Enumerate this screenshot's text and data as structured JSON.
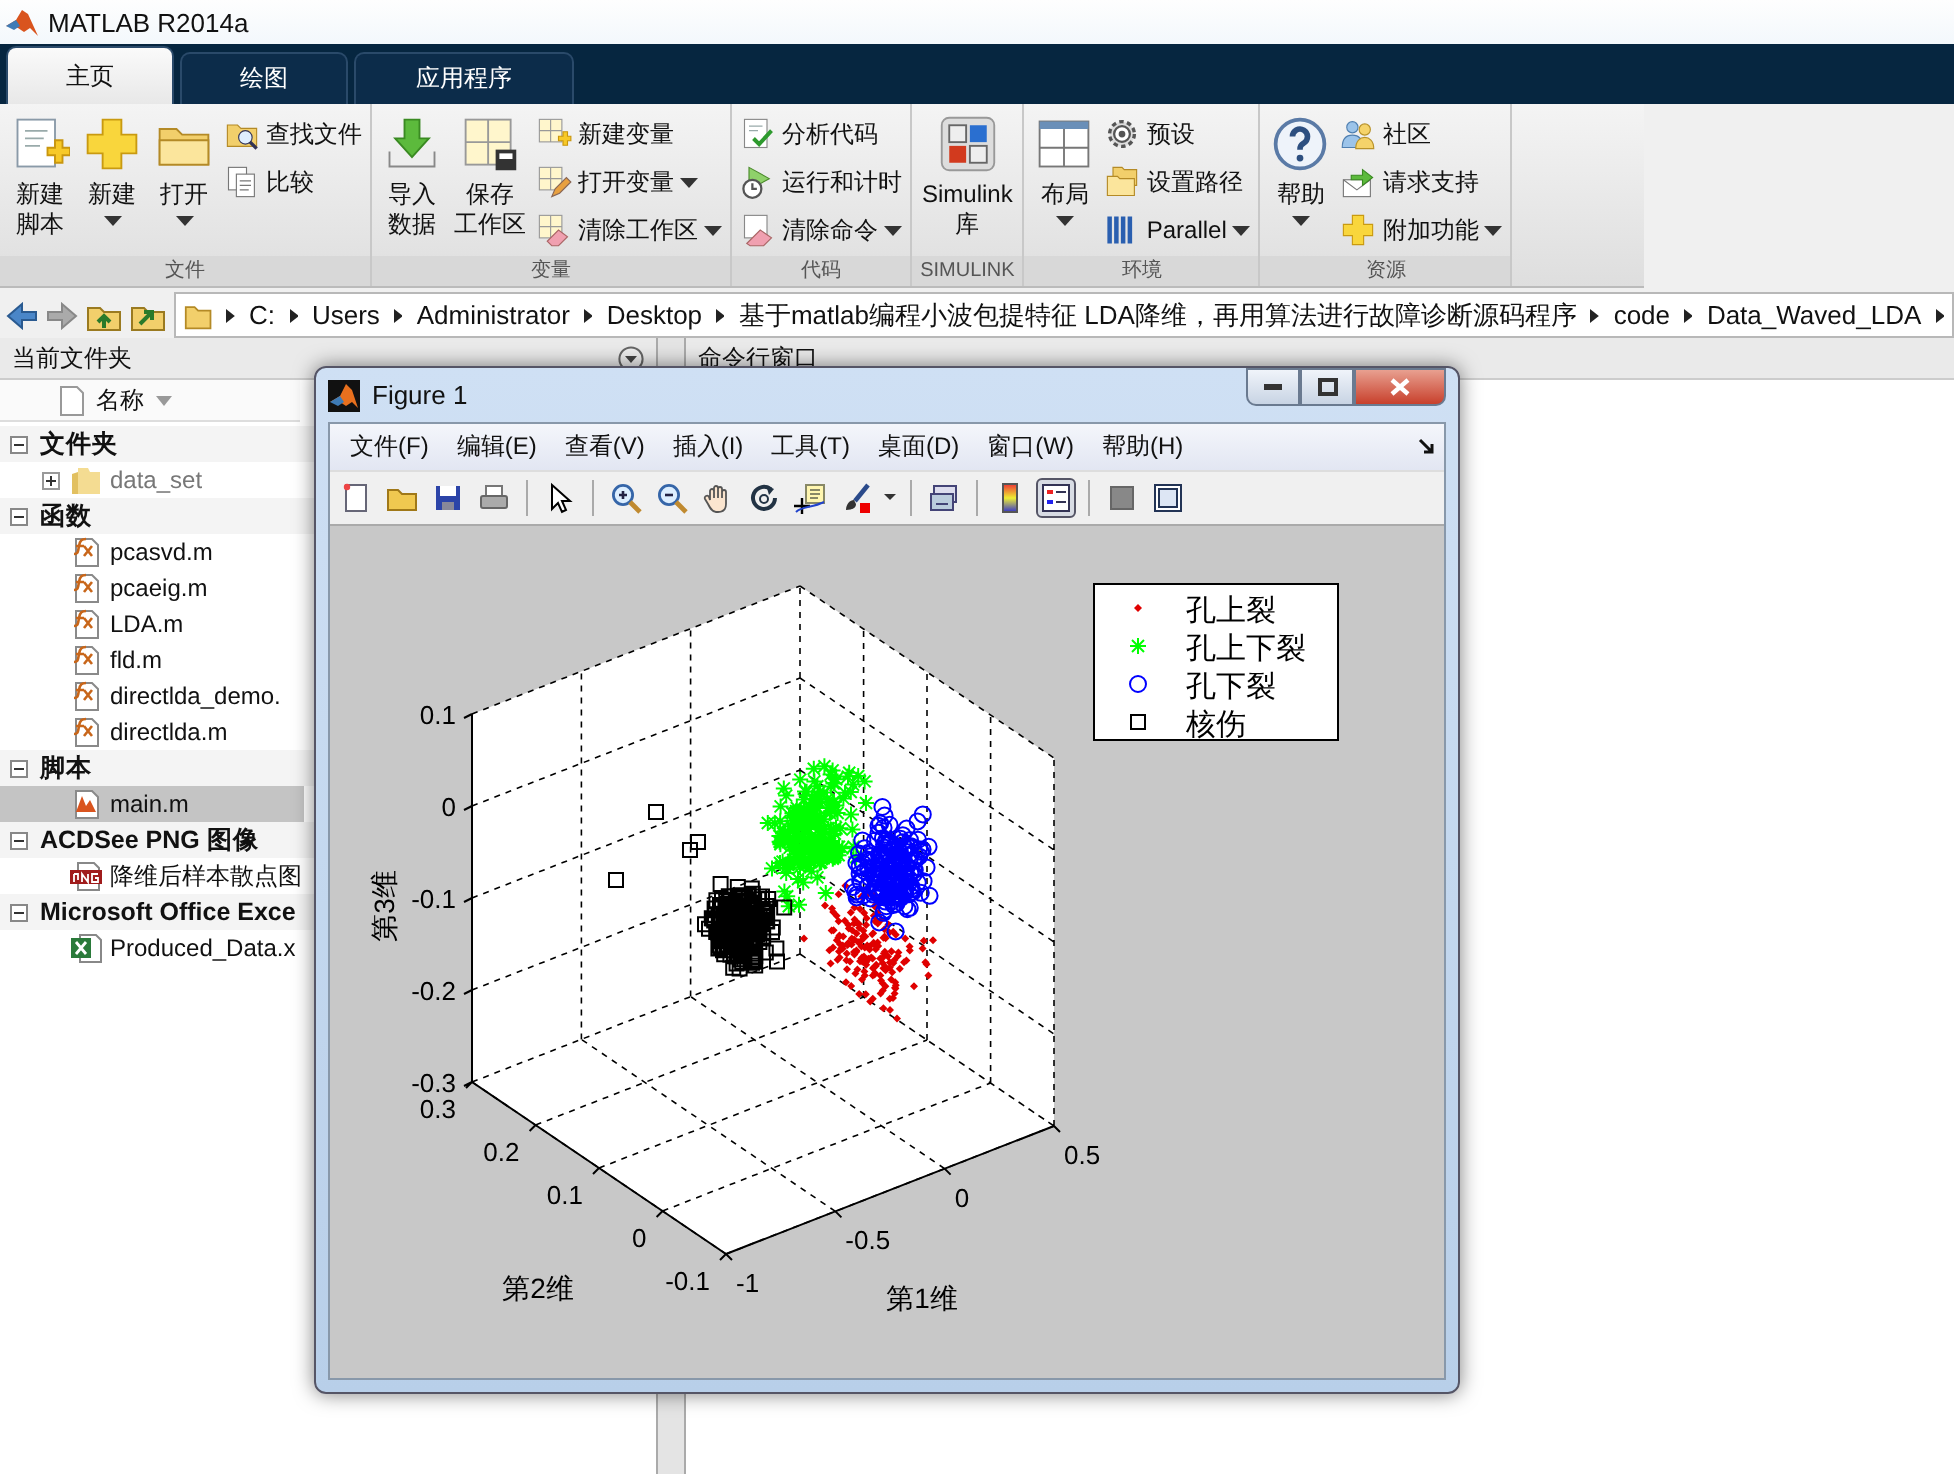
{
  "window": {
    "title": "MATLAB R2014a"
  },
  "tabs": [
    {
      "label": "主页",
      "selected": true
    },
    {
      "label": "绘图",
      "selected": false
    },
    {
      "label": "应用程序",
      "selected": false
    }
  ],
  "ribbon": {
    "groups": [
      {
        "label": "文件",
        "items": [
          {
            "kind": "large",
            "lines": [
              "新建",
              "脚本"
            ],
            "dropdown": false
          },
          {
            "kind": "large",
            "lines": [
              "新建"
            ],
            "dropdown": true
          },
          {
            "kind": "large",
            "lines": [
              "打开"
            ],
            "dropdown": true
          },
          {
            "kind": "stack",
            "items": [
              {
                "label": "查找文件",
                "dropdown": false
              },
              {
                "label": "比较",
                "dropdown": false
              }
            ]
          }
        ]
      },
      {
        "label": "变量",
        "items": [
          {
            "kind": "large",
            "lines": [
              "导入",
              "数据"
            ],
            "dropdown": false
          },
          {
            "kind": "large",
            "lines": [
              "保存",
              "工作区"
            ],
            "dropdown": false
          },
          {
            "kind": "stack",
            "items": [
              {
                "label": "新建变量",
                "dropdown": false
              },
              {
                "label": "打开变量",
                "dropdown": true
              },
              {
                "label": "清除工作区",
                "dropdown": true
              }
            ]
          }
        ]
      },
      {
        "label": "代码",
        "items": [
          {
            "kind": "stack",
            "items": [
              {
                "label": "分析代码",
                "dropdown": false
              },
              {
                "label": "运行和计时",
                "dropdown": false
              },
              {
                "label": "清除命令",
                "dropdown": true
              }
            ]
          }
        ]
      },
      {
        "label": "SIMULINK",
        "items": [
          {
            "kind": "large",
            "lines": [
              "Simulink",
              "库"
            ],
            "dropdown": false
          }
        ]
      },
      {
        "label": "环境",
        "items": [
          {
            "kind": "large",
            "lines": [
              "布局"
            ],
            "dropdown": true
          },
          {
            "kind": "stack",
            "items": [
              {
                "label": "预设",
                "dropdown": false
              },
              {
                "label": "设置路径",
                "dropdown": false
              },
              {
                "label": "Parallel",
                "dropdown": true
              }
            ]
          }
        ]
      },
      {
        "label": "资源",
        "items": [
          {
            "kind": "large",
            "lines": [
              "帮助"
            ],
            "dropdown": true
          },
          {
            "kind": "stack",
            "items": [
              {
                "label": "社区",
                "dropdown": false
              },
              {
                "label": "请求支持",
                "dropdown": false
              },
              {
                "label": "附加功能",
                "dropdown": true
              }
            ]
          }
        ]
      }
    ]
  },
  "path": [
    "C:",
    "Users",
    "Administrator",
    "Desktop",
    "基于matlab编程小波包提特征 LDA降维，再用算法进行故障诊断源码程序",
    "code",
    "Data_Waved_LDA"
  ],
  "current_folder": {
    "title": "当前文件夹",
    "column": "名称",
    "sections": [
      {
        "label": "文件夹",
        "expanded": true,
        "children": [
          {
            "label": "data_set",
            "kind": "folder",
            "expanded": false,
            "dimmed": true,
            "selected": false
          }
        ]
      },
      {
        "label": "函数",
        "expanded": true,
        "children": [
          {
            "label": "pcasvd.m",
            "kind": "function",
            "dimmed": false,
            "selected": false
          },
          {
            "label": "pcaeig.m",
            "kind": "function",
            "dimmed": false,
            "selected": false
          },
          {
            "label": "LDA.m",
            "kind": "function",
            "dimmed": false,
            "selected": false
          },
          {
            "label": "fld.m",
            "kind": "function",
            "dimmed": false,
            "selected": false
          },
          {
            "label": "directlda_demo.",
            "kind": "function",
            "dimmed": false,
            "selected": false
          },
          {
            "label": "directlda.m",
            "kind": "function",
            "dimmed": false,
            "selected": false
          }
        ]
      },
      {
        "label": "脚本",
        "expanded": true,
        "children": [
          {
            "label": "main.m",
            "kind": "script",
            "dimmed": false,
            "selected": true
          }
        ]
      },
      {
        "label": "ACDSee PNG 图像",
        "expanded": true,
        "children": [
          {
            "label": "降维后样本散点图",
            "kind": "png",
            "dimmed": false,
            "selected": false
          }
        ]
      },
      {
        "label": "Microsoft Office Exce",
        "expanded": true,
        "children": [
          {
            "label": "Produced_Data.x",
            "kind": "excel",
            "dimmed": false,
            "selected": false
          }
        ]
      }
    ]
  },
  "command_window": {
    "title": "命令行窗口"
  },
  "figure": {
    "title": "Figure 1",
    "menu": [
      "文件(F)",
      "编辑(E)",
      "查看(V)",
      "插入(I)",
      "工具(T)",
      "桌面(D)",
      "窗口(W)",
      "帮助(H)"
    ],
    "legend_button_pressed": true,
    "plot": {
      "xlabel": "第1维",
      "ylabel": "第2维",
      "zlabel": "第3维",
      "xticks": [
        "-1",
        "-0.5",
        "0",
        "0.5"
      ],
      "yticks": [
        "0.3",
        "0.2",
        "0.1",
        "0",
        "-0.1"
      ],
      "zticks": [
        "0.1",
        "0",
        "-0.1",
        "-0.2",
        "-0.3"
      ],
      "legend": [
        {
          "label": "孔上裂",
          "kind": "dot",
          "color": "#e00000"
        },
        {
          "label": "孔上下裂",
          "kind": "star",
          "color": "#00ff00"
        },
        {
          "label": "孔下裂",
          "kind": "circle",
          "color": "#0000ff"
        },
        {
          "label": "核伤",
          "kind": "square",
          "color": "#000000"
        }
      ]
    }
  }
}
